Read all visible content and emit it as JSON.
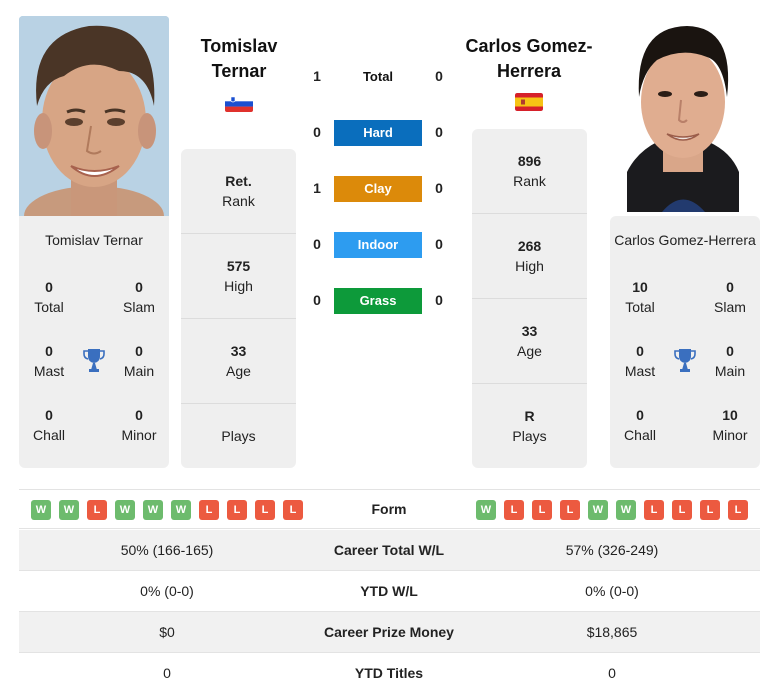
{
  "player1": {
    "name_heading_line1": "Tomislav",
    "name_heading_line2": "Ternar",
    "full_name": "Tomislav Ternar",
    "flag": "slovenia-flag",
    "photo": "player-photo",
    "titles": {
      "total": {
        "value": "0",
        "label": "Total"
      },
      "slam": {
        "value": "0",
        "label": "Slam"
      },
      "mast": {
        "value": "0",
        "label": "Mast"
      },
      "main": {
        "value": "0",
        "label": "Main"
      },
      "chall": {
        "value": "0",
        "label": "Chall"
      },
      "minor": {
        "value": "0",
        "label": "Minor"
      }
    },
    "stats": {
      "rank": {
        "value": "Ret.",
        "label": "Rank"
      },
      "high": {
        "value": "575",
        "label": "High"
      },
      "age": {
        "value": "33",
        "label": "Age"
      },
      "plays": {
        "value": "",
        "label": "Plays"
      }
    },
    "form": [
      "W",
      "W",
      "L",
      "W",
      "W",
      "W",
      "L",
      "L",
      "L",
      "L"
    ]
  },
  "player2": {
    "name_heading_line1": "Carlos Gomez-",
    "name_heading_line2": "Herrera",
    "full_name": "Carlos Gomez-Herrera",
    "flag": "spain-flag",
    "photo": "player-photo",
    "titles": {
      "total": {
        "value": "10",
        "label": "Total"
      },
      "slam": {
        "value": "0",
        "label": "Slam"
      },
      "mast": {
        "value": "0",
        "label": "Mast"
      },
      "main": {
        "value": "0",
        "label": "Main"
      },
      "chall": {
        "value": "0",
        "label": "Chall"
      },
      "minor": {
        "value": "10",
        "label": "Minor"
      }
    },
    "stats": {
      "rank": {
        "value": "896",
        "label": "Rank"
      },
      "high": {
        "value": "268",
        "label": "High"
      },
      "age": {
        "value": "33",
        "label": "Age"
      },
      "plays": {
        "value": "R",
        "label": "Plays"
      }
    },
    "form": [
      "W",
      "L",
      "L",
      "L",
      "W",
      "W",
      "L",
      "L",
      "L",
      "L"
    ]
  },
  "h2h": {
    "total": {
      "label": "Total",
      "p1": "1",
      "p2": "0"
    },
    "surfaces": [
      {
        "label": "Hard",
        "p1": "0",
        "p2": "0",
        "color": "#0a6ebd"
      },
      {
        "label": "Clay",
        "p1": "1",
        "p2": "0",
        "color": "#dc8a0a"
      },
      {
        "label": "Indoor",
        "p1": "0",
        "p2": "0",
        "color": "#2d9cf0"
      },
      {
        "label": "Grass",
        "p1": "0",
        "p2": "0",
        "color": "#0d9a3a"
      }
    ]
  },
  "form_label": "Form",
  "comparison": [
    {
      "label": "Career Total W/L",
      "p1": "50% (166-165)",
      "p2": "57% (326-249)"
    },
    {
      "label": "YTD W/L",
      "p1": "0% (0-0)",
      "p2": "0% (0-0)"
    },
    {
      "label": "Career Prize Money",
      "p1": "$0",
      "p2": "$18,865"
    },
    {
      "label": "YTD Titles",
      "p1": "0",
      "p2": "0"
    }
  ],
  "colors": {
    "win": "#6dbb6d",
    "loss": "#ec5a40",
    "trophy": "#3a6fbf",
    "card_bg": "#efefef"
  }
}
